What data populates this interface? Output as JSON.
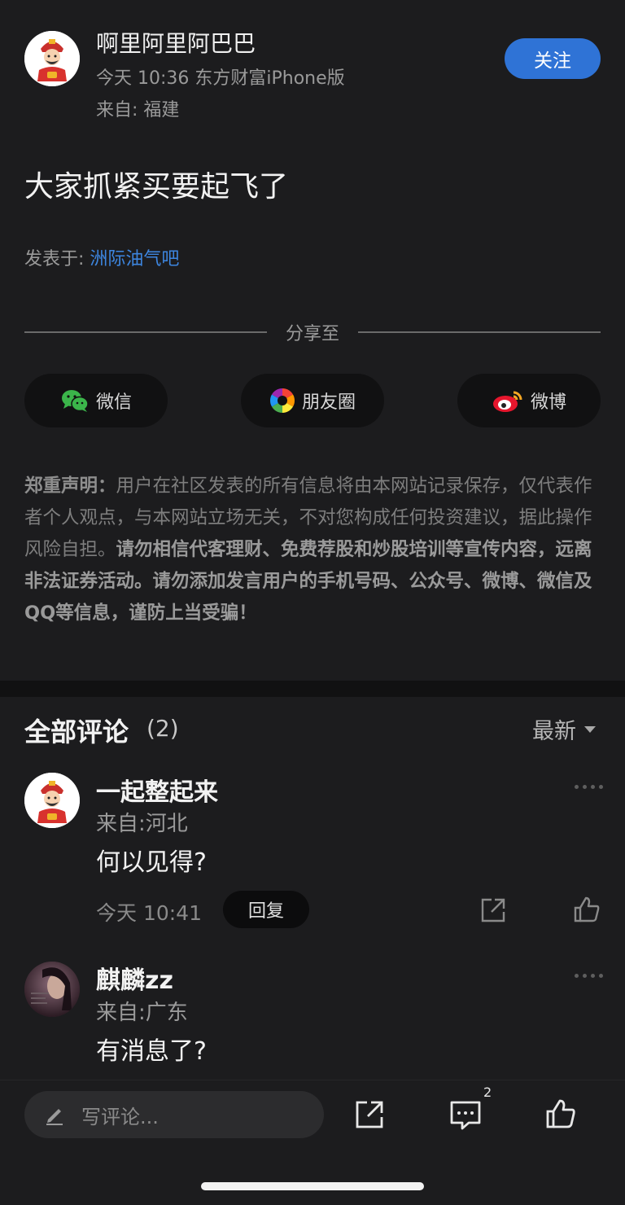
{
  "post": {
    "author": {
      "name": "啊里阿里阿巴巴",
      "meta": "今天 10:36 东方财富iPhone版",
      "location": "来自: 福建",
      "avatar_icon": "caishen-avatar"
    },
    "follow_label": "关注",
    "content": "大家抓紧买要起飞了",
    "posted_in_label": "发表于: ",
    "forum": "洲际油气吧"
  },
  "share": {
    "title": "分享至",
    "buttons": [
      {
        "label": "微信",
        "icon": "wechat-icon"
      },
      {
        "label": "朋友圈",
        "icon": "moments-icon"
      },
      {
        "label": "微博",
        "icon": "weibo-icon"
      }
    ]
  },
  "disclaimer": {
    "heading": "郑重声明：",
    "normal": "用户在社区发表的所有信息将由本网站记录保存，仅代表作者个人观点，与本网站立场无关，不对您构成任何投资建议，据此操作风险自担。",
    "strong": "请勿相信代客理财、免费荐股和炒股培训等宣传内容，远离非法证券活动。请勿添加发言用户的手机号码、公众号、微博、微信及QQ等信息，谨防上当受骗！"
  },
  "comments": {
    "title": "全部评论",
    "count": "(2)",
    "sort_label": "最新",
    "items": [
      {
        "name": "一起整起来",
        "location": "来自:河北",
        "text": "何以见得?",
        "time": "今天 10:41",
        "reply_label": "回复"
      },
      {
        "name": "麒麟zz",
        "location": "来自:广东",
        "text": "有消息了?"
      }
    ]
  },
  "bottom_bar": {
    "input_placeholder": "写评论...",
    "comment_count": "2"
  },
  "colors": {
    "background": "#1c1c1e",
    "accent": "#2f73d6",
    "link": "#3d86e0"
  }
}
